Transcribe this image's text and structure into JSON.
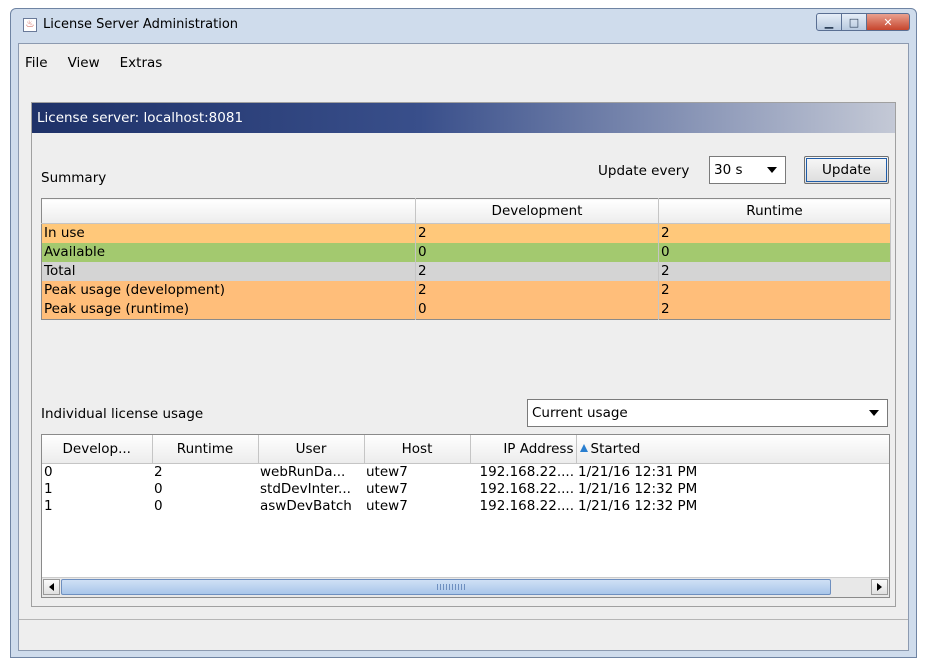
{
  "window": {
    "title": "License Server Administration",
    "minimize_glyph": "▁",
    "maximize_glyph": "□",
    "close_glyph": "✕",
    "app_icon_glyph": "♨"
  },
  "menu": {
    "file": "File",
    "view": "View",
    "extras": "Extras"
  },
  "server": {
    "label": "License server: localhost:8081"
  },
  "summary": {
    "label": "Summary",
    "update_every_label": "Update every",
    "interval_value": "30 s",
    "update_button": "Update",
    "columns": [
      "",
      "Development",
      "Runtime"
    ],
    "rows": [
      {
        "label": "In use",
        "development": "2",
        "runtime": "2",
        "color": "#ffc87a"
      },
      {
        "label": "Available",
        "development": "0",
        "runtime": "0",
        "color": "#a3c96f"
      },
      {
        "label": "Total",
        "development": "2",
        "runtime": "2",
        "color": "#d4d4d4"
      },
      {
        "label": "Peak usage (development)",
        "development": "2",
        "runtime": "2",
        "color": "#ffbe7a"
      },
      {
        "label": "Peak usage (runtime)",
        "development": "0",
        "runtime": "2",
        "color": "#ffbe7a"
      }
    ]
  },
  "individual": {
    "label": "Individual license usage",
    "view_selection": "Current usage",
    "columns": [
      "Develop...",
      "Runtime",
      "User",
      "Host",
      "IP Address",
      "Started"
    ],
    "sorted_column": "Started",
    "rows": [
      {
        "development": "0",
        "runtime": "2",
        "user": "webRunDa...",
        "host": "utew7",
        "ip": "192.168.22....",
        "started": "1/21/16 12:31 PM"
      },
      {
        "development": "1",
        "runtime": "0",
        "user": "stdDevInter...",
        "host": "utew7",
        "ip": "192.168.22....",
        "started": "1/21/16 12:32 PM"
      },
      {
        "development": "1",
        "runtime": "0",
        "user": "aswDevBatch",
        "host": "utew7",
        "ip": "192.168.22....",
        "started": "1/21/16 12:32 PM"
      }
    ]
  }
}
